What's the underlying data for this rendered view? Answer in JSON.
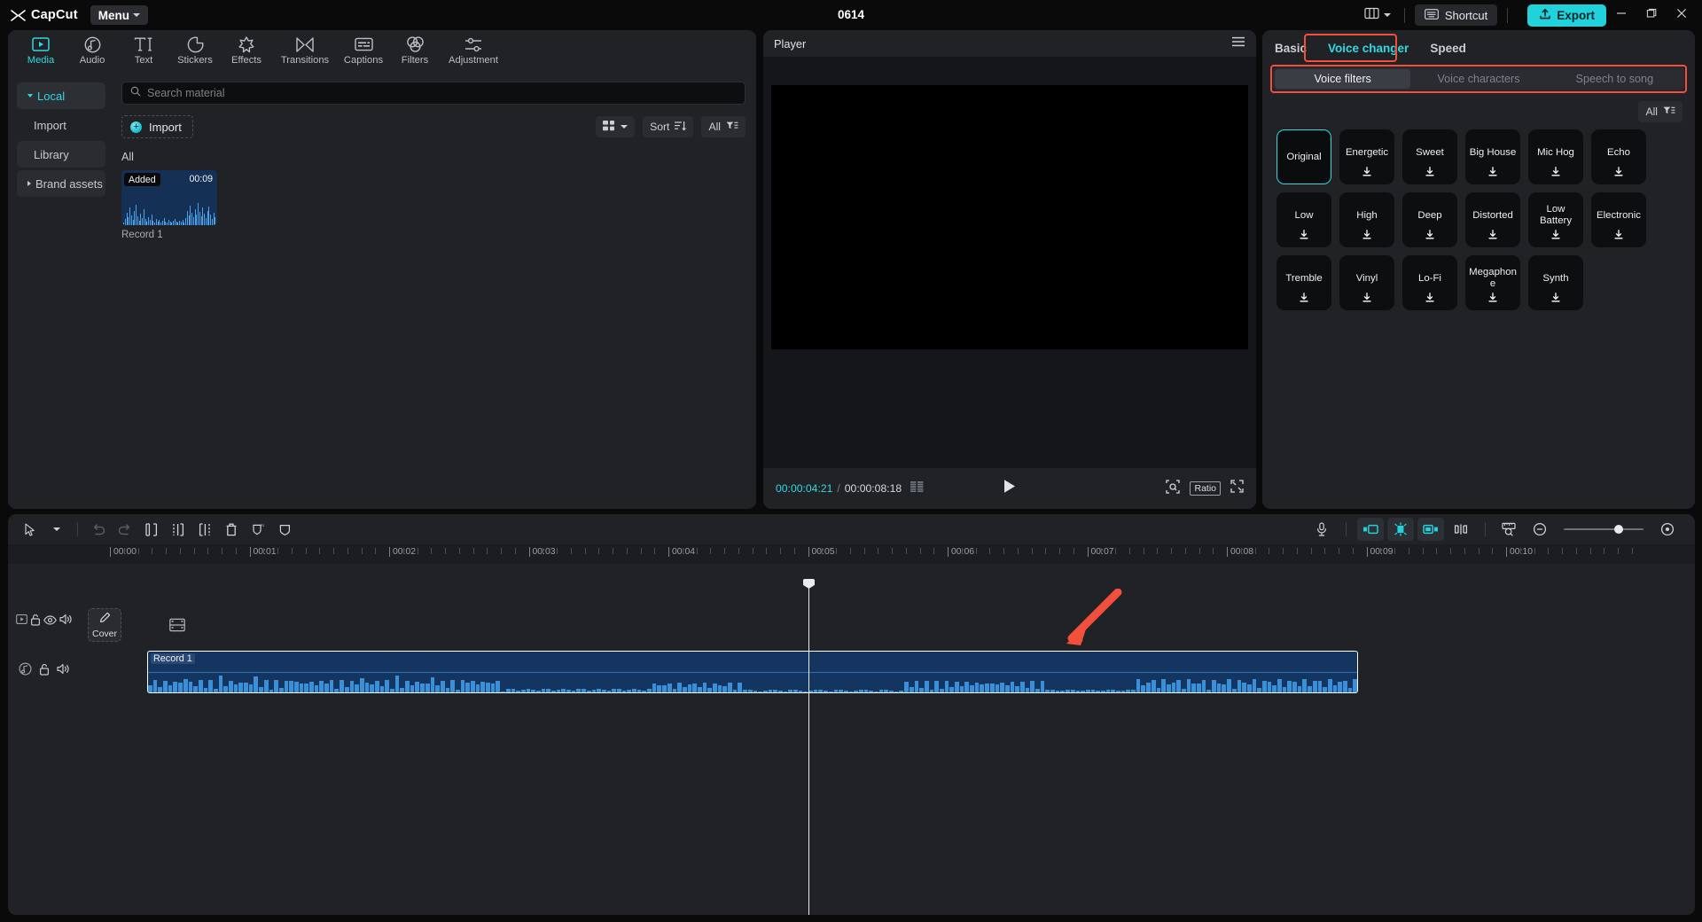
{
  "titlebar": {
    "brand": "CapCut",
    "menu_label": "Menu",
    "project_title": "0614",
    "layout_icon": "layout-icon",
    "shortcut_label": "Shortcut",
    "export_label": "Export",
    "minimize_icon": "minimize-icon",
    "maximize_icon": "maximize-icon",
    "close_icon": "close-icon"
  },
  "toolbar": {
    "items": [
      {
        "label": "Media",
        "icon": "media-icon",
        "active": true
      },
      {
        "label": "Audio",
        "icon": "audio-icon",
        "active": false
      },
      {
        "label": "Text",
        "icon": "text-icon",
        "active": false
      },
      {
        "label": "Stickers",
        "icon": "stickers-icon",
        "active": false
      },
      {
        "label": "Effects",
        "icon": "effects-icon",
        "active": false
      },
      {
        "label": "Transitions",
        "icon": "transitions-icon",
        "active": false
      },
      {
        "label": "Captions",
        "icon": "captions-icon",
        "active": false
      },
      {
        "label": "Filters",
        "icon": "filters-icon",
        "active": false
      },
      {
        "label": "Adjustment",
        "icon": "adjustment-icon",
        "active": false
      }
    ]
  },
  "media": {
    "nav": [
      {
        "label": "Local",
        "selected": true,
        "expandable": "down"
      },
      {
        "label": "Import",
        "selected": false,
        "expandable": ""
      },
      {
        "label": "Library",
        "selected": false,
        "expandable": ""
      },
      {
        "label": "Brand assets",
        "selected": false,
        "expandable": "right"
      }
    ],
    "search_placeholder": "Search material",
    "search_value": "",
    "import_label": "Import",
    "view_chip": "grid-view",
    "sort_label": "Sort",
    "filter_label": "All",
    "section_label": "All",
    "items": [
      {
        "name": "Record 1",
        "badge": "Added",
        "duration": "00:09"
      }
    ]
  },
  "player": {
    "title": "Player",
    "menu_icon": "hamburger-icon",
    "current_time": "00:00:04:21",
    "time_separator": "/",
    "total_time": "00:00:08:18",
    "frames_icon": "frames-icon",
    "play_icon": "play-icon",
    "crop_icon": "crop-icon",
    "ratio_label": "Ratio",
    "fullscreen_icon": "fullscreen-icon"
  },
  "right_panel": {
    "tabs": [
      {
        "label": "Basic",
        "active": false,
        "highlighted": false
      },
      {
        "label": "Voice changer",
        "active": true,
        "highlighted": true
      },
      {
        "label": "Speed",
        "active": false,
        "highlighted": false
      }
    ],
    "segments": [
      {
        "label": "Voice filters",
        "active": true
      },
      {
        "label": "Voice characters",
        "active": false
      },
      {
        "label": "Speech to song",
        "active": false
      }
    ],
    "filter_label": "All",
    "accent_color": "#2fd9e3",
    "highlight_color": "#f2503c",
    "voice_filters": [
      {
        "label": "Original",
        "selected": true,
        "download": false
      },
      {
        "label": "Energetic",
        "selected": false,
        "download": true
      },
      {
        "label": "Sweet",
        "selected": false,
        "download": true
      },
      {
        "label": "Big House",
        "selected": false,
        "download": true
      },
      {
        "label": "Mic Hog",
        "selected": false,
        "download": true
      },
      {
        "label": "Echo",
        "selected": false,
        "download": true
      },
      {
        "label": "Low",
        "selected": false,
        "download": true
      },
      {
        "label": "High",
        "selected": false,
        "download": true
      },
      {
        "label": "Deep",
        "selected": false,
        "download": true
      },
      {
        "label": "Distorted",
        "selected": false,
        "download": true
      },
      {
        "label": "Low Battery",
        "selected": false,
        "download": true
      },
      {
        "label": "Electronic",
        "selected": false,
        "download": true
      },
      {
        "label": "Tremble",
        "selected": false,
        "download": true
      },
      {
        "label": "Vinyl",
        "selected": false,
        "download": true
      },
      {
        "label": "Lo-Fi",
        "selected": false,
        "download": true
      },
      {
        "label": "Megaphone",
        "selected": false,
        "download": true
      },
      {
        "label": "Synth",
        "selected": false,
        "download": true
      }
    ]
  },
  "timeline": {
    "tools": [
      {
        "icon": "select-cursor-icon"
      },
      {
        "icon": "chevron-down-icon"
      },
      {
        "icon": "undo-icon"
      },
      {
        "icon": "redo-icon"
      },
      {
        "icon": "split-icon"
      },
      {
        "icon": "trim-left-icon"
      },
      {
        "icon": "trim-right-icon"
      },
      {
        "icon": "delete-icon"
      },
      {
        "icon": "ai-mask-icon"
      },
      {
        "icon": "mask-icon"
      }
    ],
    "right_tools": [
      {
        "icon": "microphone-icon",
        "active": false
      },
      {
        "icon": "snap-left-icon",
        "active": true
      },
      {
        "icon": "auto-snap-icon",
        "active": true
      },
      {
        "icon": "snap-right-icon",
        "active": true
      },
      {
        "icon": "link-split-icon",
        "active": false
      },
      {
        "icon": "timeline-zoom-fit-icon",
        "active": false
      },
      {
        "icon": "zoom-out-icon",
        "active": false
      },
      {
        "icon": "zoom-in-icon",
        "active": false
      }
    ],
    "ruler_labels": [
      "00:00",
      "00:01",
      "00:02",
      "00:03",
      "00:04",
      "00:05",
      "00:06",
      "00:07",
      "00:08",
      "00:09",
      "00:10"
    ],
    "cover_label": "Cover",
    "cover_icon": "pencil-icon",
    "video_track_icon": "film-icon",
    "video_track_controls": [
      "video-toggle-icon",
      "lock-icon",
      "eye-icon",
      "speaker-icon"
    ],
    "audio_track_controls": [
      "audio-note-icon",
      "lock-icon",
      "speaker-icon"
    ],
    "clips": [
      {
        "name": "Record 1",
        "type": "audio",
        "selected": true
      }
    ],
    "playhead_time": "00:00:04:21"
  },
  "annotations": {
    "arrow_color": "#f2503c",
    "arrow_target": "audio-clip-right-portion"
  }
}
